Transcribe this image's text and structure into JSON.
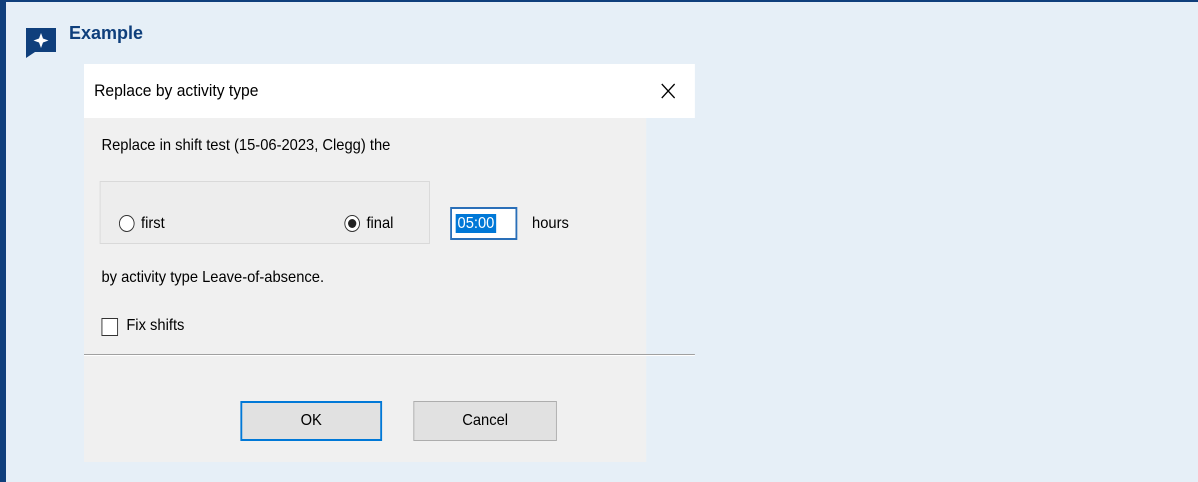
{
  "callout": {
    "title": "Example",
    "icon": "sparkle-speech-bubble-icon",
    "accent_color": "#0f3f7c",
    "background_color": "#e6eff7"
  },
  "dialog": {
    "title": "Replace by activity type",
    "close_icon": "close-icon",
    "intro_text": "Replace in shift test (15-06-2023, Clegg) the",
    "options": [
      {
        "label": "first",
        "selected": false
      },
      {
        "label": "final",
        "selected": true
      }
    ],
    "hours_value": "05:00",
    "hours_label": "hours",
    "activity_text": "by activity type Leave-of-absence.",
    "fix_shifts": {
      "label": "Fix shifts",
      "checked": false
    },
    "ok_label": "OK",
    "cancel_label": "Cancel"
  }
}
